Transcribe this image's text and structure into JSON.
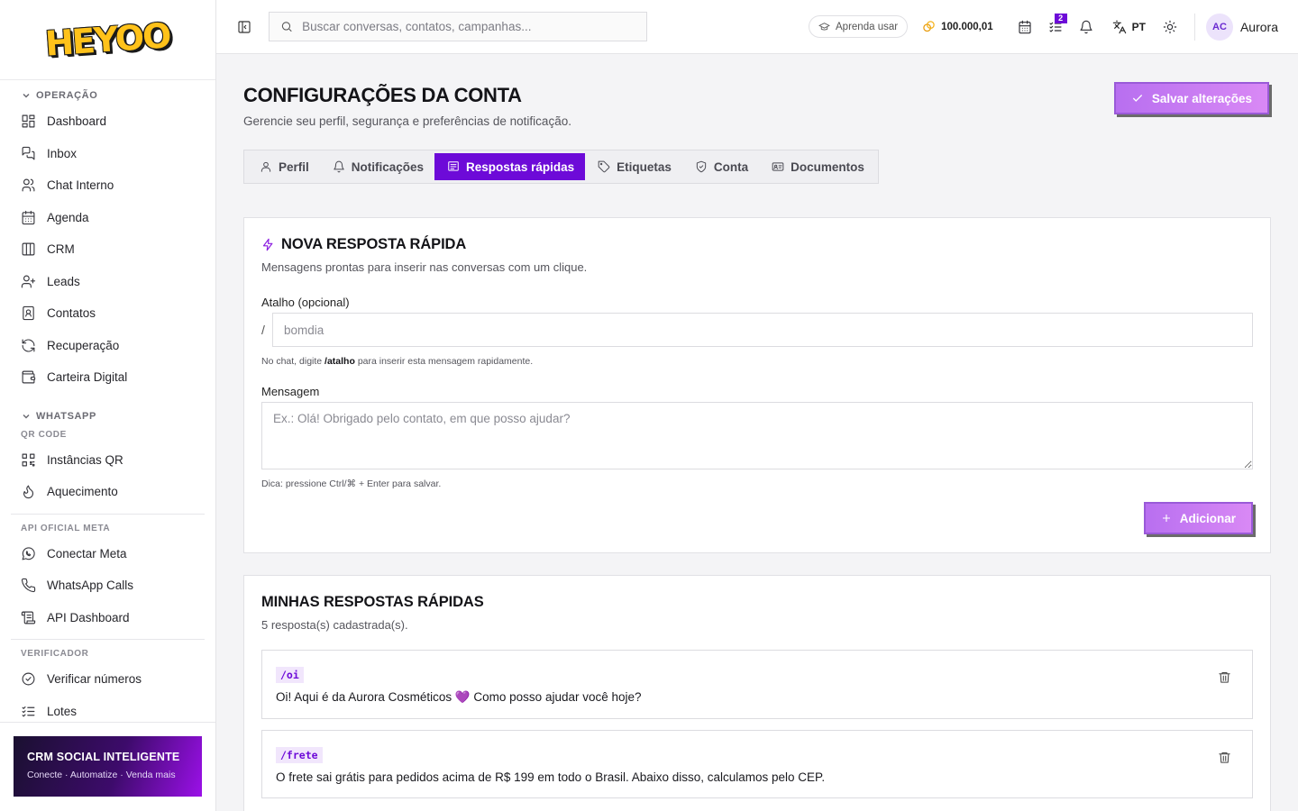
{
  "brand": {
    "logo_text": "HEYOO"
  },
  "sidebar": {
    "sections": {
      "operacao": "OPERAÇÃO",
      "whatsapp": "WHATSAPP",
      "qr_code": "QR CODE",
      "api_meta": "API OFICIAL META",
      "verificador": "VERIFICADOR"
    },
    "items": {
      "dashboard": "Dashboard",
      "inbox": "Inbox",
      "chat_interno": "Chat Interno",
      "agenda": "Agenda",
      "crm": "CRM",
      "leads": "Leads",
      "contatos": "Contatos",
      "recuperacao": "Recuperação",
      "carteira": "Carteira Digital",
      "instancias": "Instâncias QR",
      "aquecimento": "Aquecimento",
      "conectar_meta": "Conectar Meta",
      "whatsapp_calls": "WhatsApp Calls",
      "api_dashboard": "API Dashboard",
      "verificar": "Verificar números",
      "lotes": "Lotes"
    },
    "promo": {
      "title": "CRM SOCIAL INTELIGENTE",
      "subtitle": "Conecte · Automatize · Venda mais"
    }
  },
  "topbar": {
    "search_placeholder": "Buscar conversas, contatos, campanhas...",
    "learn_label": "Aprenda usar",
    "credits": "100.000,01",
    "tasks_badge": "2",
    "language": "PT",
    "user_initials": "AC",
    "user_name": "Aurora"
  },
  "page": {
    "title": "CONFIGURAÇÕES DA CONTA",
    "subtitle": "Gerencie seu perfil, segurança e preferências de notificação.",
    "save_label": "Salvar alterações",
    "tabs": {
      "perfil": "Perfil",
      "notificacoes": "Notificações",
      "respostas": "Respostas rápidas",
      "etiquetas": "Etiquetas",
      "conta": "Conta",
      "documentos": "Documentos"
    }
  },
  "new_reply": {
    "title": "NOVA RESPOSTA RÁPIDA",
    "subtitle": "Mensagens prontas para inserir nas conversas com um clique.",
    "shortcut_label": "Atalho (opcional)",
    "slash": "/",
    "shortcut_placeholder": "bomdia",
    "hint_pre": "No chat, digite",
    "hint_code": "/atalho",
    "hint_post": "para inserir esta mensagem rapidamente.",
    "message_label": "Mensagem",
    "message_placeholder": "Ex.: Olá! Obrigado pelo contato, em que posso ajudar?",
    "tip": "Dica: pressione Ctrl/⌘ + Enter para salvar.",
    "add_label": "Adicionar"
  },
  "my_replies": {
    "title": "MINHAS RESPOSTAS RÁPIDAS",
    "count": "5 resposta(s) cadastrada(s).",
    "items": [
      {
        "code": "/oi",
        "text": "Oi! Aqui é da Aurora Cosméticos 💜 Como posso ajudar você hoje?"
      },
      {
        "code": "/frete",
        "text": "O frete sai grátis para pedidos acima de R$ 199 em todo o Brasil. Abaixo disso, calculamos pelo CEP."
      }
    ]
  }
}
